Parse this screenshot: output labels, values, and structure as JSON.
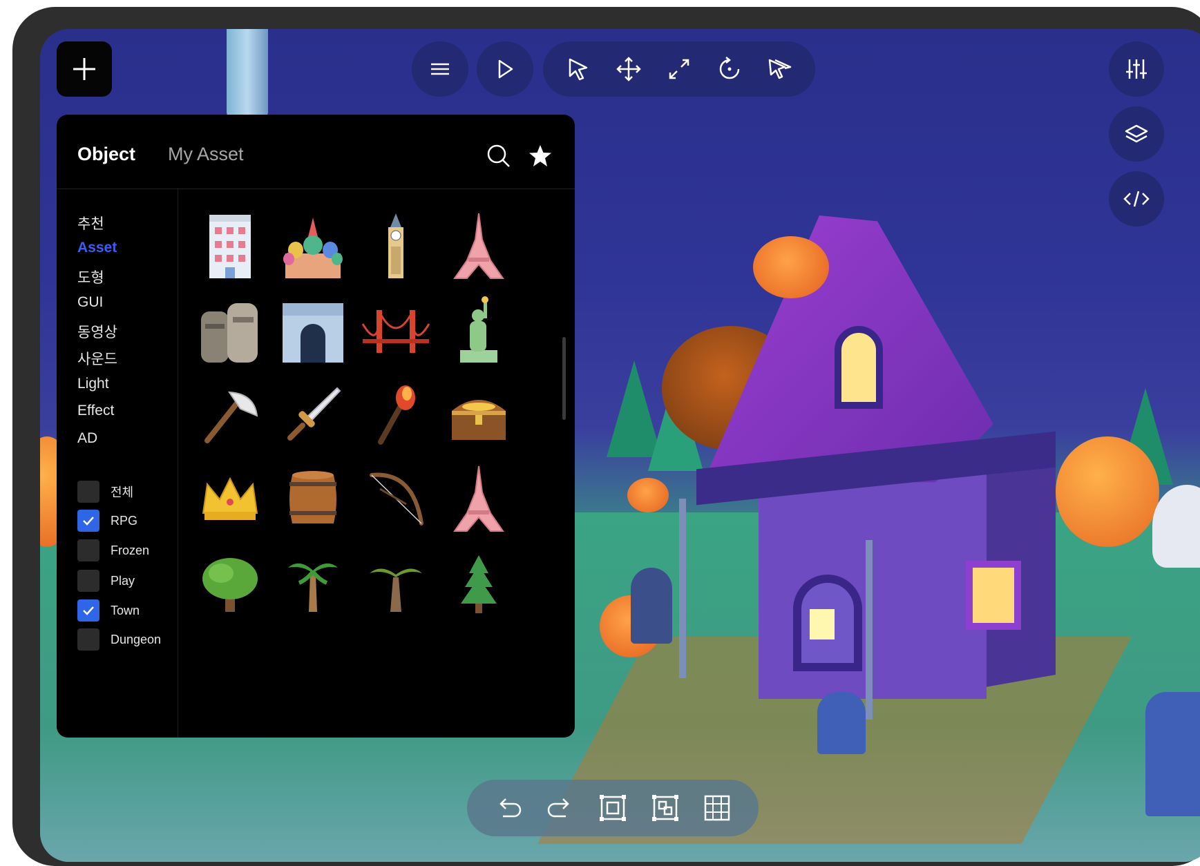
{
  "toolbar": {
    "add": "add-button",
    "menu": "menu-button",
    "play": "play-button",
    "tools": [
      "select",
      "move",
      "scale",
      "rotate",
      "multi-select"
    ],
    "right": [
      "settings-sliders",
      "layers",
      "code"
    ]
  },
  "panel": {
    "tabs": {
      "object": "Object",
      "my_asset": "My Asset"
    },
    "categories": [
      {
        "label": "추천",
        "active": false
      },
      {
        "label": "Asset",
        "active": true
      },
      {
        "label": "도형",
        "active": false
      },
      {
        "label": "GUI",
        "active": false
      },
      {
        "label": "동영상",
        "active": false
      },
      {
        "label": "사운드",
        "active": false
      },
      {
        "label": "Light",
        "active": false
      },
      {
        "label": "Effect",
        "active": false
      },
      {
        "label": "AD",
        "active": false
      }
    ],
    "filters": [
      {
        "label": "전체",
        "checked": false
      },
      {
        "label": "RPG",
        "checked": true
      },
      {
        "label": "Frozen",
        "checked": false
      },
      {
        "label": "Play",
        "checked": false
      },
      {
        "label": "Town",
        "checked": true
      },
      {
        "label": "Dungeon",
        "checked": false
      }
    ],
    "assets": [
      [
        "building",
        "cathedral",
        "clock-tower",
        "eiffel-tower"
      ],
      [
        "moai",
        "arc-de-triomphe",
        "golden-gate-bridge",
        "statue-of-liberty"
      ],
      [
        "axe",
        "sword",
        "torch",
        "treasure-chest"
      ],
      [
        "crown",
        "barrel",
        "bow",
        "eiffel-tower"
      ],
      [
        "tree",
        "palm-tree",
        "palm-tree-small",
        "pine-tree"
      ]
    ]
  },
  "bottom_toolbar": [
    "undo",
    "redo",
    "frame",
    "group",
    "grid"
  ],
  "colors": {
    "accent": "#3d5cf5",
    "checkbox_checked": "#2f66e8",
    "panel_bg": "#000000",
    "toolbar_bg": "#23286e"
  }
}
